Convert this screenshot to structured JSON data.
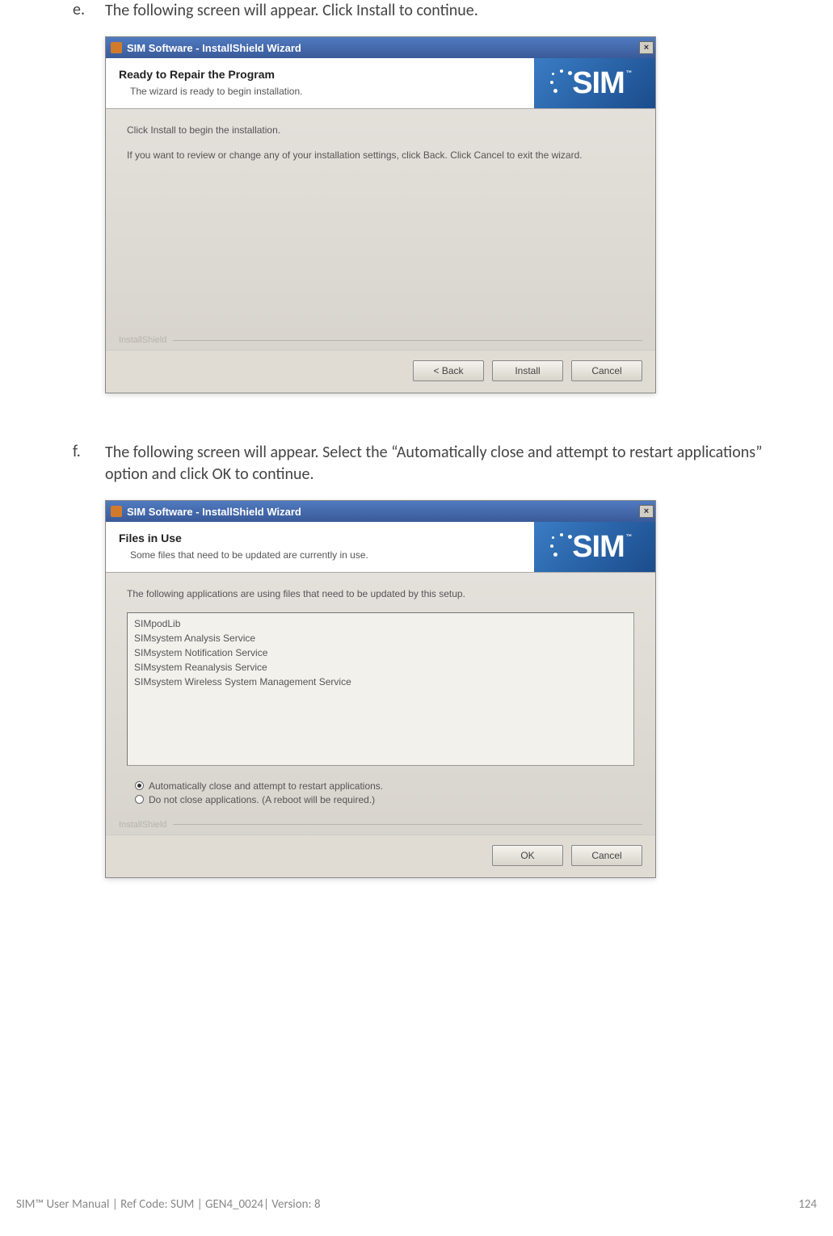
{
  "steps": {
    "e": {
      "letter": "e.",
      "text": "The following screen will appear. Click Install to continue."
    },
    "f": {
      "letter": "f.",
      "text": "The following screen will appear. Select the “Automatically close and attempt to restart applications” option and click OK to continue."
    }
  },
  "dialog1": {
    "title": "SIM Software - InstallShield Wizard",
    "header_title": "Ready to Repair the Program",
    "header_subtitle": "The wizard is ready to begin installation.",
    "body_line1": "Click Install to begin the installation.",
    "body_line2": "If you want to review or change any of your installation settings, click Back. Click Cancel to exit the wizard.",
    "brand": "InstallShield",
    "buttons": {
      "back": "< Back",
      "install": "Install",
      "cancel": "Cancel"
    },
    "logo": "SIM"
  },
  "dialog2": {
    "title": "SIM Software - InstallShield Wizard",
    "header_title": "Files in Use",
    "header_subtitle": "Some files that need to be updated are currently in use.",
    "body_intro": "The following applications are using files that need to be updated by this setup.",
    "apps": [
      "SIMpodLib",
      "SIMsystem Analysis Service",
      "SIMsystem Notification Service",
      "SIMsystem Reanalysis Service",
      "SIMsystem Wireless System Management Service"
    ],
    "radio1": "Automatically close and attempt to restart applications.",
    "radio2": "Do not close applications. (A reboot will be required.)",
    "brand": "InstallShield",
    "buttons": {
      "ok": "OK",
      "cancel": "Cancel"
    },
    "logo": "SIM"
  },
  "footer": {
    "left": "SIM™ User Manual | Ref Code: SUM | GEN4_0024| Version: 8",
    "right": "124"
  }
}
